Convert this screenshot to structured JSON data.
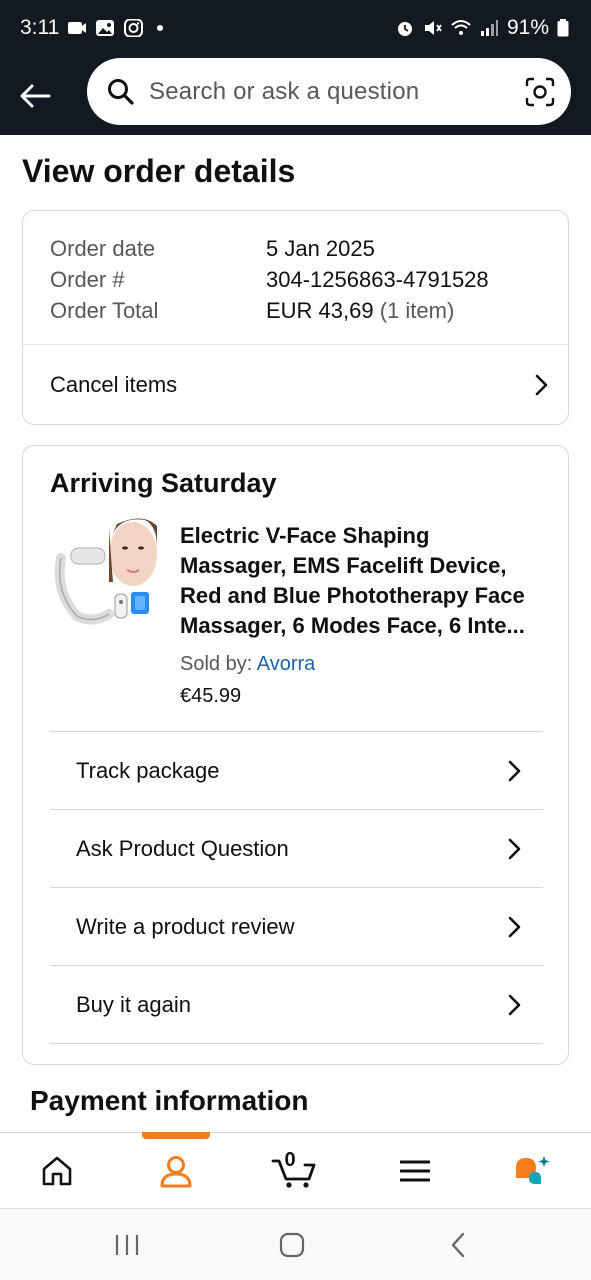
{
  "status_bar": {
    "time": "3:11",
    "battery": "91%"
  },
  "search": {
    "placeholder": "Search or ask a question"
  },
  "page": {
    "title": "View order details"
  },
  "order": {
    "date_label": "Order date",
    "date_value": "5 Jan 2025",
    "number_label": "Order #",
    "number_value": "304-1256863-4791528",
    "total_label": "Order Total",
    "total_value": "EUR 43,69",
    "total_items": "(1 item)",
    "cancel_label": "Cancel items"
  },
  "shipment": {
    "heading": "Arriving Saturday",
    "product_title": "Electric V-Face Shaping Massager, EMS Facelift Device, Red and Blue Phototherapy Face Massager, 6 Modes Face, 6 Inte...",
    "sold_by_label": "Sold by: ",
    "seller": "Avorra",
    "price": "€45.99",
    "actions": [
      {
        "label": "Track package"
      },
      {
        "label": "Ask Product Question"
      },
      {
        "label": "Write a product review"
      },
      {
        "label": "Buy it again"
      }
    ]
  },
  "payment": {
    "heading": "Payment information"
  },
  "bottom_nav": {
    "items": [
      "home-icon",
      "account-icon",
      "cart-icon",
      "menu-icon",
      "rufus-icon"
    ],
    "cart_count": "0",
    "active_color": "#f77c1b"
  },
  "colors": {
    "header_bg": "#131921",
    "link": "#2162a1",
    "accent": "#f77c1b"
  }
}
